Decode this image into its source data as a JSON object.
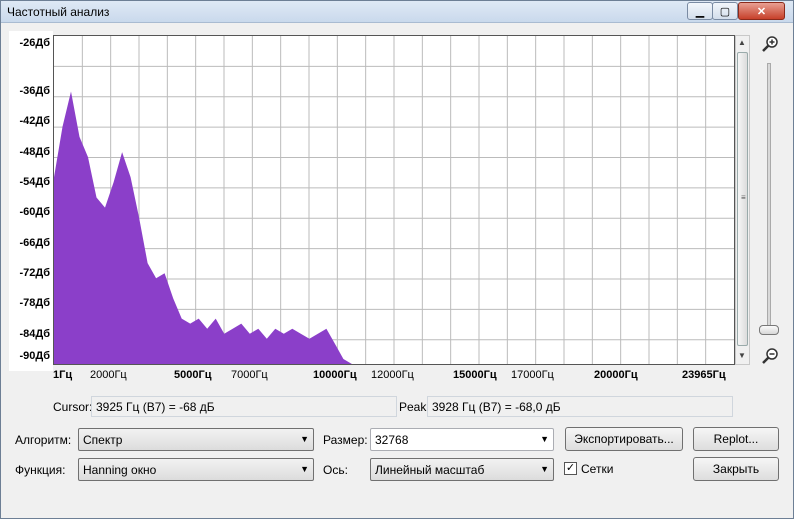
{
  "window": {
    "title": "Частотный анализ"
  },
  "titlebar": {
    "minimize_glyph": "▁",
    "maximize_glyph": "▢",
    "close_glyph": "✕"
  },
  "plot": {
    "y_ticks": [
      "-26Дб",
      "-36Дб",
      "-42Дб",
      "-48Дб",
      "-54Дб",
      "-60Дб",
      "-66Дб",
      "-72Дб",
      "-78Дб",
      "-84Дб",
      "-90Дб"
    ],
    "x_ticks": [
      {
        "label": "1Гц",
        "bold": true
      },
      {
        "label": "2000Гц",
        "bold": false
      },
      {
        "label": "5000Гц",
        "bold": true
      },
      {
        "label": "7000Гц",
        "bold": false
      },
      {
        "label": "10000Гц",
        "bold": true
      },
      {
        "label": "12000Гц",
        "bold": false
      },
      {
        "label": "15000Гц",
        "bold": true
      },
      {
        "label": "17000Гц",
        "bold": false
      },
      {
        "label": "20000Гц",
        "bold": true
      },
      {
        "label": "23965Гц",
        "bold": true
      }
    ],
    "fill_color": "#8b3fc9",
    "grid_color": "#bbbbbb"
  },
  "chart_data": {
    "type": "area",
    "x": [
      0,
      300,
      600,
      900,
      1200,
      1500,
      1800,
      2100,
      2400,
      2700,
      3000,
      3300,
      3600,
      3900,
      4200,
      4500,
      4800,
      5100,
      5400,
      5700,
      6000,
      6300,
      6600,
      6900,
      7200,
      7500,
      7800,
      8100,
      8400,
      8700,
      9000,
      9300,
      9600,
      9900,
      10200,
      10500,
      11000,
      12000,
      14000,
      16000,
      18000,
      20000,
      22000,
      23965
    ],
    "y": [
      -54,
      -44,
      -37,
      -46,
      -50,
      -58,
      -60,
      -55,
      -49,
      -54,
      -62,
      -71,
      -74,
      -73,
      -78,
      -82,
      -83,
      -82,
      -84,
      -82,
      -85,
      -84,
      -83,
      -85,
      -84,
      -86,
      -84,
      -85,
      -84,
      -85,
      -86,
      -85,
      -84,
      -87,
      -90,
      -91,
      -91,
      -91,
      -91,
      -91,
      -91,
      -91,
      -91,
      -91
    ],
    "xlim": [
      1,
      23965
    ],
    "ylim": [
      -91,
      -26
    ],
    "grid": true
  },
  "cursor": {
    "label": "Cursor:",
    "value": "3925 Гц (B7) = -68 дБ"
  },
  "peak": {
    "label": "Peak:",
    "value": "3928 Гц (B7) = -68,0 дБ"
  },
  "controls": {
    "algorithm_label": "Алгоритм:",
    "algorithm_value": "Спектр",
    "function_label": "Функция:",
    "function_value": "Hanning окно",
    "size_label": "Размер:",
    "size_value": "32768",
    "axis_label": "Ось:",
    "axis_value": "Линейный масштаб",
    "export_button": "Экспортировать...",
    "replot_button": "Replot...",
    "close_button": "Закрыть",
    "grids_label": "Сетки",
    "grids_checked": "✓"
  }
}
